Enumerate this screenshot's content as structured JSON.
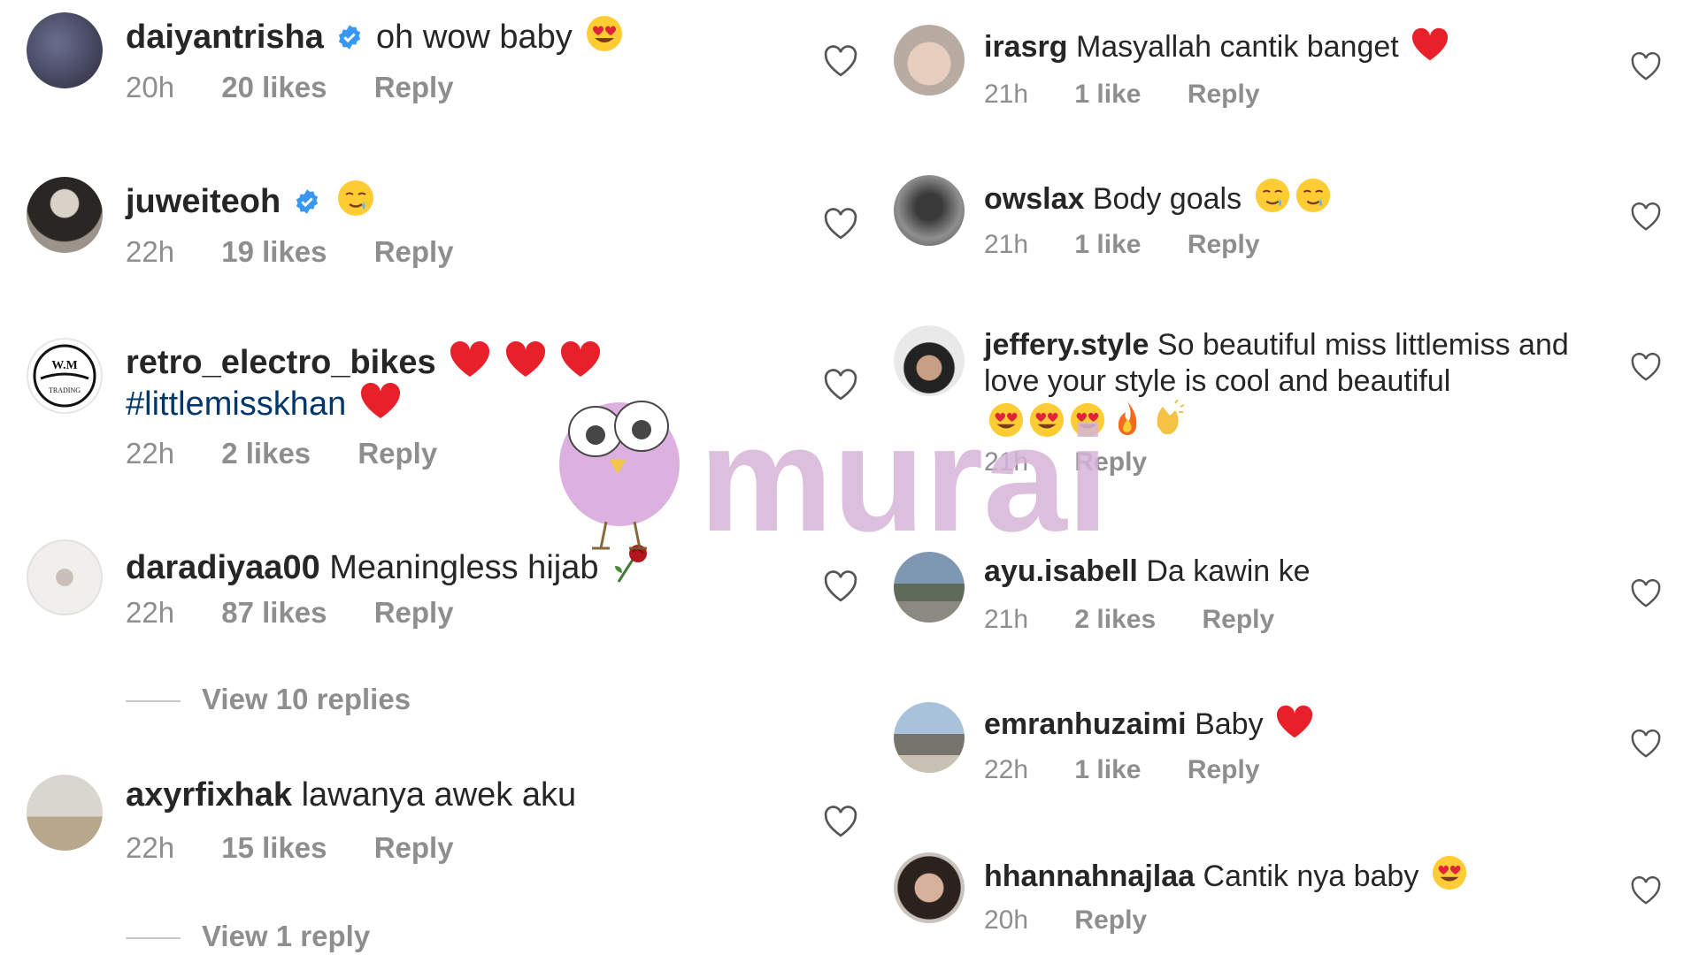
{
  "left_comments": [
    {
      "username": "daiyantrisha",
      "verified": true,
      "text": "oh wow baby",
      "time": "20h",
      "likes": "20 likes",
      "reply": "Reply"
    },
    {
      "username": "juweiteoh",
      "verified": true,
      "text": "",
      "time": "22h",
      "likes": "19 likes",
      "reply": "Reply"
    },
    {
      "username": "retro_electro_bikes",
      "verified": false,
      "text": "",
      "hashtag": "#littlemisskhan",
      "time": "22h",
      "likes": "2 likes",
      "reply": "Reply"
    },
    {
      "username": "daradiyaa00",
      "verified": false,
      "text": "Meaningless hijab",
      "time": "22h",
      "likes": "87 likes",
      "reply": "Reply",
      "view_replies": "View 10 replies"
    },
    {
      "username": "axyrfixhak",
      "verified": false,
      "text": "lawanya awek aku",
      "time": "22h",
      "likes": "15 likes",
      "reply": "Reply",
      "view_replies": "View 1 reply"
    }
  ],
  "right_comments": [
    {
      "username": "irasrg",
      "text": "Masyallah cantik banget",
      "time": "21h",
      "likes": "1 like",
      "reply": "Reply"
    },
    {
      "username": "owslax",
      "text": "Body goals",
      "time": "21h",
      "likes": "1 like",
      "reply": "Reply"
    },
    {
      "username": "jeffery.style",
      "text": "So beautiful miss littlemiss and love  your style is cool and beautiful",
      "time": "21h",
      "likes": "",
      "reply": "Reply"
    },
    {
      "username": "ayu.isabell",
      "text": "Da kawin ke",
      "time": "21h",
      "likes": "2 likes",
      "reply": "Reply"
    },
    {
      "username": "emranhuzaimi",
      "text": "Baby",
      "time": "22h",
      "likes": "1 like",
      "reply": "Reply"
    },
    {
      "username": "hhannahnajlaa",
      "text": "Cantik nya baby",
      "time": "20h",
      "likes": "",
      "reply": "Reply"
    }
  ],
  "watermark": {
    "text": "murai"
  },
  "avatar_logo": {
    "line1": "W.M",
    "line2": "TRADING"
  },
  "colors": {
    "verified": "#3897f0",
    "hashtag": "#00376b",
    "muted": "#8e8e8e",
    "watermark": "#d7b5d8"
  }
}
